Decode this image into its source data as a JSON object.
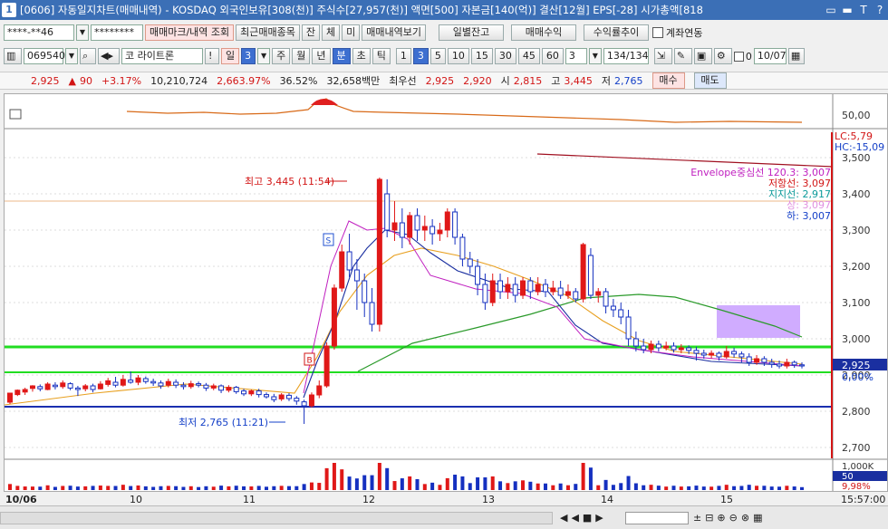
{
  "title": {
    "app_no": "1",
    "text": "[0606] 자동일지차트(매매내역) - KOSDAQ 외국인보유[308(천)] 주식수[27,957(천)] 액면[500] 자본금[140(억)] 결산[12월] EPS[-28] 시가총액[818"
  },
  "window_buttons": [
    "▭",
    "▬",
    "T",
    "?"
  ],
  "toolbar1": {
    "account": "****-**46",
    "password": "********",
    "buttons": [
      "매매마크/내역 조회",
      "최근매매종목",
      "잔",
      "체",
      "미",
      "매매내역보기",
      "일별잔고",
      "매매수익",
      "수익률추이"
    ],
    "checkbox_label": "계좌연동"
  },
  "toolbar2": {
    "code": "069540",
    "name": "코 라이트론",
    "period_buttons": [
      "주",
      "월",
      "년",
      "분",
      "초",
      "틱",
      "1",
      "3",
      "5",
      "10",
      "15",
      "30",
      "45",
      "60"
    ],
    "day_label": "일",
    "day_value": "3",
    "minute_value": "3",
    "count": "134/134",
    "zero": "0",
    "date": "10/07"
  },
  "quote": {
    "price": "2,925",
    "change": "90",
    "change_pct": "+3.17%",
    "volume": "10,210,724",
    "vol_ratio": "2,663.97%",
    "turnover": "36.52%",
    "amount": "32,658백만",
    "best_label": "최우선",
    "best_ask": "2,925",
    "best_bid": "2,920",
    "open_label": "시",
    "open": "2,815",
    "high_label": "고",
    "high": "3,445",
    "low_label": "저",
    "low": "2,765",
    "buy": "매수",
    "sell": "매도"
  },
  "chart_labels": {
    "stoch_50": "50,00",
    "lc": "LC:5,79",
    "hc": "HC:-15,09",
    "env_mid": "Envelope중심선 120.3: 3,007",
    "resist": "저항선: 3,097",
    "support": "지지선: 2,917",
    "env_small": "상: 3,097",
    "lower": "하: 3,007",
    "high_note": "최고 3,445 (11:54)",
    "low_note": "최저 2,765 (11:21)",
    "price_tag": "2,925",
    "pct_tag": "0,00%",
    "vol_1m": "1,000K",
    "vol_50": "50",
    "vol_pct": "9,98%",
    "date_start": "10/06",
    "time_end": "15:57:00"
  },
  "chart_data": {
    "type": "candlestick",
    "y_ticks": [
      "3,500",
      "3,400",
      "3,300",
      "3,200",
      "3,100",
      "3,000",
      "2,900",
      "2,800",
      "2,700"
    ],
    "x_ticks": [
      "10",
      "11",
      "12",
      "13",
      "14",
      "15"
    ],
    "candles": [
      [
        2825,
        2850,
        2840,
        2820
      ],
      [
        2846,
        2858,
        2860,
        2842
      ],
      [
        2853,
        2860,
        2865,
        2845
      ],
      [
        2863,
        2870,
        2872,
        2854
      ],
      [
        2868,
        2862,
        2874,
        2855
      ],
      [
        2860,
        2875,
        2880,
        2858
      ],
      [
        2872,
        2868,
        2880,
        2860
      ],
      [
        2868,
        2878,
        2885,
        2862
      ],
      [
        2876,
        2864,
        2880,
        2858
      ],
      [
        2864,
        2860,
        2870,
        2842
      ],
      [
        2862,
        2870,
        2875,
        2855
      ],
      [
        2870,
        2860,
        2876,
        2852
      ],
      [
        2862,
        2875,
        2883,
        2860
      ],
      [
        2874,
        2884,
        2892,
        2868
      ],
      [
        2880,
        2872,
        2895,
        2866
      ],
      [
        2872,
        2888,
        2900,
        2868
      ],
      [
        2886,
        2880,
        2910,
        2876
      ],
      [
        2880,
        2892,
        2900,
        2872
      ],
      [
        2890,
        2882,
        2896,
        2876
      ],
      [
        2882,
        2878,
        2890,
        2870
      ],
      [
        2878,
        2870,
        2885,
        2862
      ],
      [
        2872,
        2882,
        2890,
        2866
      ],
      [
        2880,
        2872,
        2888,
        2864
      ],
      [
        2872,
        2868,
        2880,
        2860
      ],
      [
        2868,
        2876,
        2884,
        2862
      ],
      [
        2876,
        2872,
        2882,
        2866
      ],
      [
        2872,
        2864,
        2878,
        2856
      ],
      [
        2864,
        2870,
        2876,
        2858
      ],
      [
        2870,
        2858,
        2874,
        2850
      ],
      [
        2858,
        2866,
        2872,
        2852
      ],
      [
        2866,
        2854,
        2870,
        2848
      ],
      [
        2856,
        2848,
        2862,
        2842
      ],
      [
        2848,
        2856,
        2860,
        2842
      ],
      [
        2856,
        2846,
        2862,
        2838
      ],
      [
        2846,
        2840,
        2852,
        2835
      ],
      [
        2840,
        2832,
        2848,
        2825
      ],
      [
        2834,
        2845,
        2850,
        2828
      ],
      [
        2844,
        2835,
        2850,
        2828
      ],
      [
        2836,
        2828,
        2842,
        2818
      ],
      [
        2826,
        2815,
        2832,
        2765
      ],
      [
        2815,
        2845,
        2852,
        2810
      ],
      [
        2845,
        2870,
        2885,
        2836
      ],
      [
        2870,
        2980,
        2990,
        2865
      ],
      [
        2980,
        3140,
        3150,
        2970
      ],
      [
        3140,
        3240,
        3260,
        3130
      ],
      [
        3240,
        3190,
        3290,
        3170
      ],
      [
        3190,
        3160,
        3220,
        3080
      ],
      [
        3160,
        3100,
        3180,
        3060
      ],
      [
        3100,
        3040,
        3140,
        3020
      ],
      [
        3040,
        3440,
        3445,
        3020
      ],
      [
        3400,
        3300,
        3440,
        3280
      ],
      [
        3300,
        3320,
        3380,
        3270
      ],
      [
        3320,
        3280,
        3360,
        3250
      ],
      [
        3280,
        3340,
        3350,
        3260
      ],
      [
        3340,
        3300,
        3360,
        3270
      ],
      [
        3300,
        3310,
        3340,
        3270
      ],
      [
        3310,
        3290,
        3330,
        3260
      ],
      [
        3290,
        3300,
        3320,
        3270
      ],
      [
        3300,
        3350,
        3360,
        3280
      ],
      [
        3350,
        3280,
        3360,
        3260
      ],
      [
        3280,
        3220,
        3290,
        3200
      ],
      [
        3220,
        3200,
        3240,
        3180
      ],
      [
        3200,
        3150,
        3220,
        3120
      ],
      [
        3150,
        3100,
        3180,
        3080
      ],
      [
        3100,
        3160,
        3180,
        3090
      ],
      [
        3160,
        3130,
        3180,
        3110
      ],
      [
        3130,
        3150,
        3170,
        3110
      ],
      [
        3150,
        3120,
        3170,
        3100
      ],
      [
        3120,
        3160,
        3170,
        3110
      ],
      [
        3160,
        3130,
        3170,
        3110
      ],
      [
        3130,
        3150,
        3170,
        3120
      ],
      [
        3150,
        3130,
        3165,
        3115
      ],
      [
        3130,
        3140,
        3160,
        3120
      ],
      [
        3140,
        3120,
        3160,
        3110
      ],
      [
        3120,
        3130,
        3150,
        3110
      ],
      [
        3130,
        3110,
        3140,
        3100
      ],
      [
        3110,
        3260,
        3265,
        3100
      ],
      [
        3230,
        3120,
        3250,
        3110
      ],
      [
        3120,
        3130,
        3140,
        3100
      ],
      [
        3130,
        3090,
        3140,
        3070
      ],
      [
        3090,
        3080,
        3110,
        3060
      ],
      [
        3080,
        3060,
        3100,
        3040
      ],
      [
        3060,
        3000,
        3080,
        2980
      ],
      [
        3000,
        2980,
        3020,
        2965
      ],
      [
        2980,
        2970,
        3000,
        2960
      ],
      [
        2970,
        2985,
        2995,
        2960
      ],
      [
        2985,
        2975,
        2995,
        2965
      ],
      [
        2975,
        2980,
        2992,
        2968
      ],
      [
        2980,
        2970,
        2990,
        2962
      ],
      [
        2970,
        2975,
        2985,
        2960
      ],
      [
        2975,
        2968,
        2982,
        2958
      ],
      [
        2968,
        2960,
        2978,
        2940
      ],
      [
        2960,
        2955,
        2970,
        2945
      ],
      [
        2955,
        2960,
        2968,
        2946
      ],
      [
        2960,
        2950,
        2965,
        2940
      ],
      [
        2950,
        2965,
        2980,
        2945
      ],
      [
        2965,
        2958,
        2975,
        2948
      ],
      [
        2958,
        2950,
        2965,
        2935
      ],
      [
        2950,
        2935,
        2960,
        2925
      ],
      [
        2935,
        2945,
        2955,
        2928
      ],
      [
        2945,
        2935,
        2952,
        2925
      ],
      [
        2935,
        2930,
        2945,
        2920
      ],
      [
        2930,
        2925,
        2940,
        2918
      ],
      [
        2925,
        2935,
        2945,
        2918
      ],
      [
        2935,
        2928,
        2940,
        2920
      ],
      [
        2928,
        2925,
        2935,
        2918
      ]
    ]
  }
}
